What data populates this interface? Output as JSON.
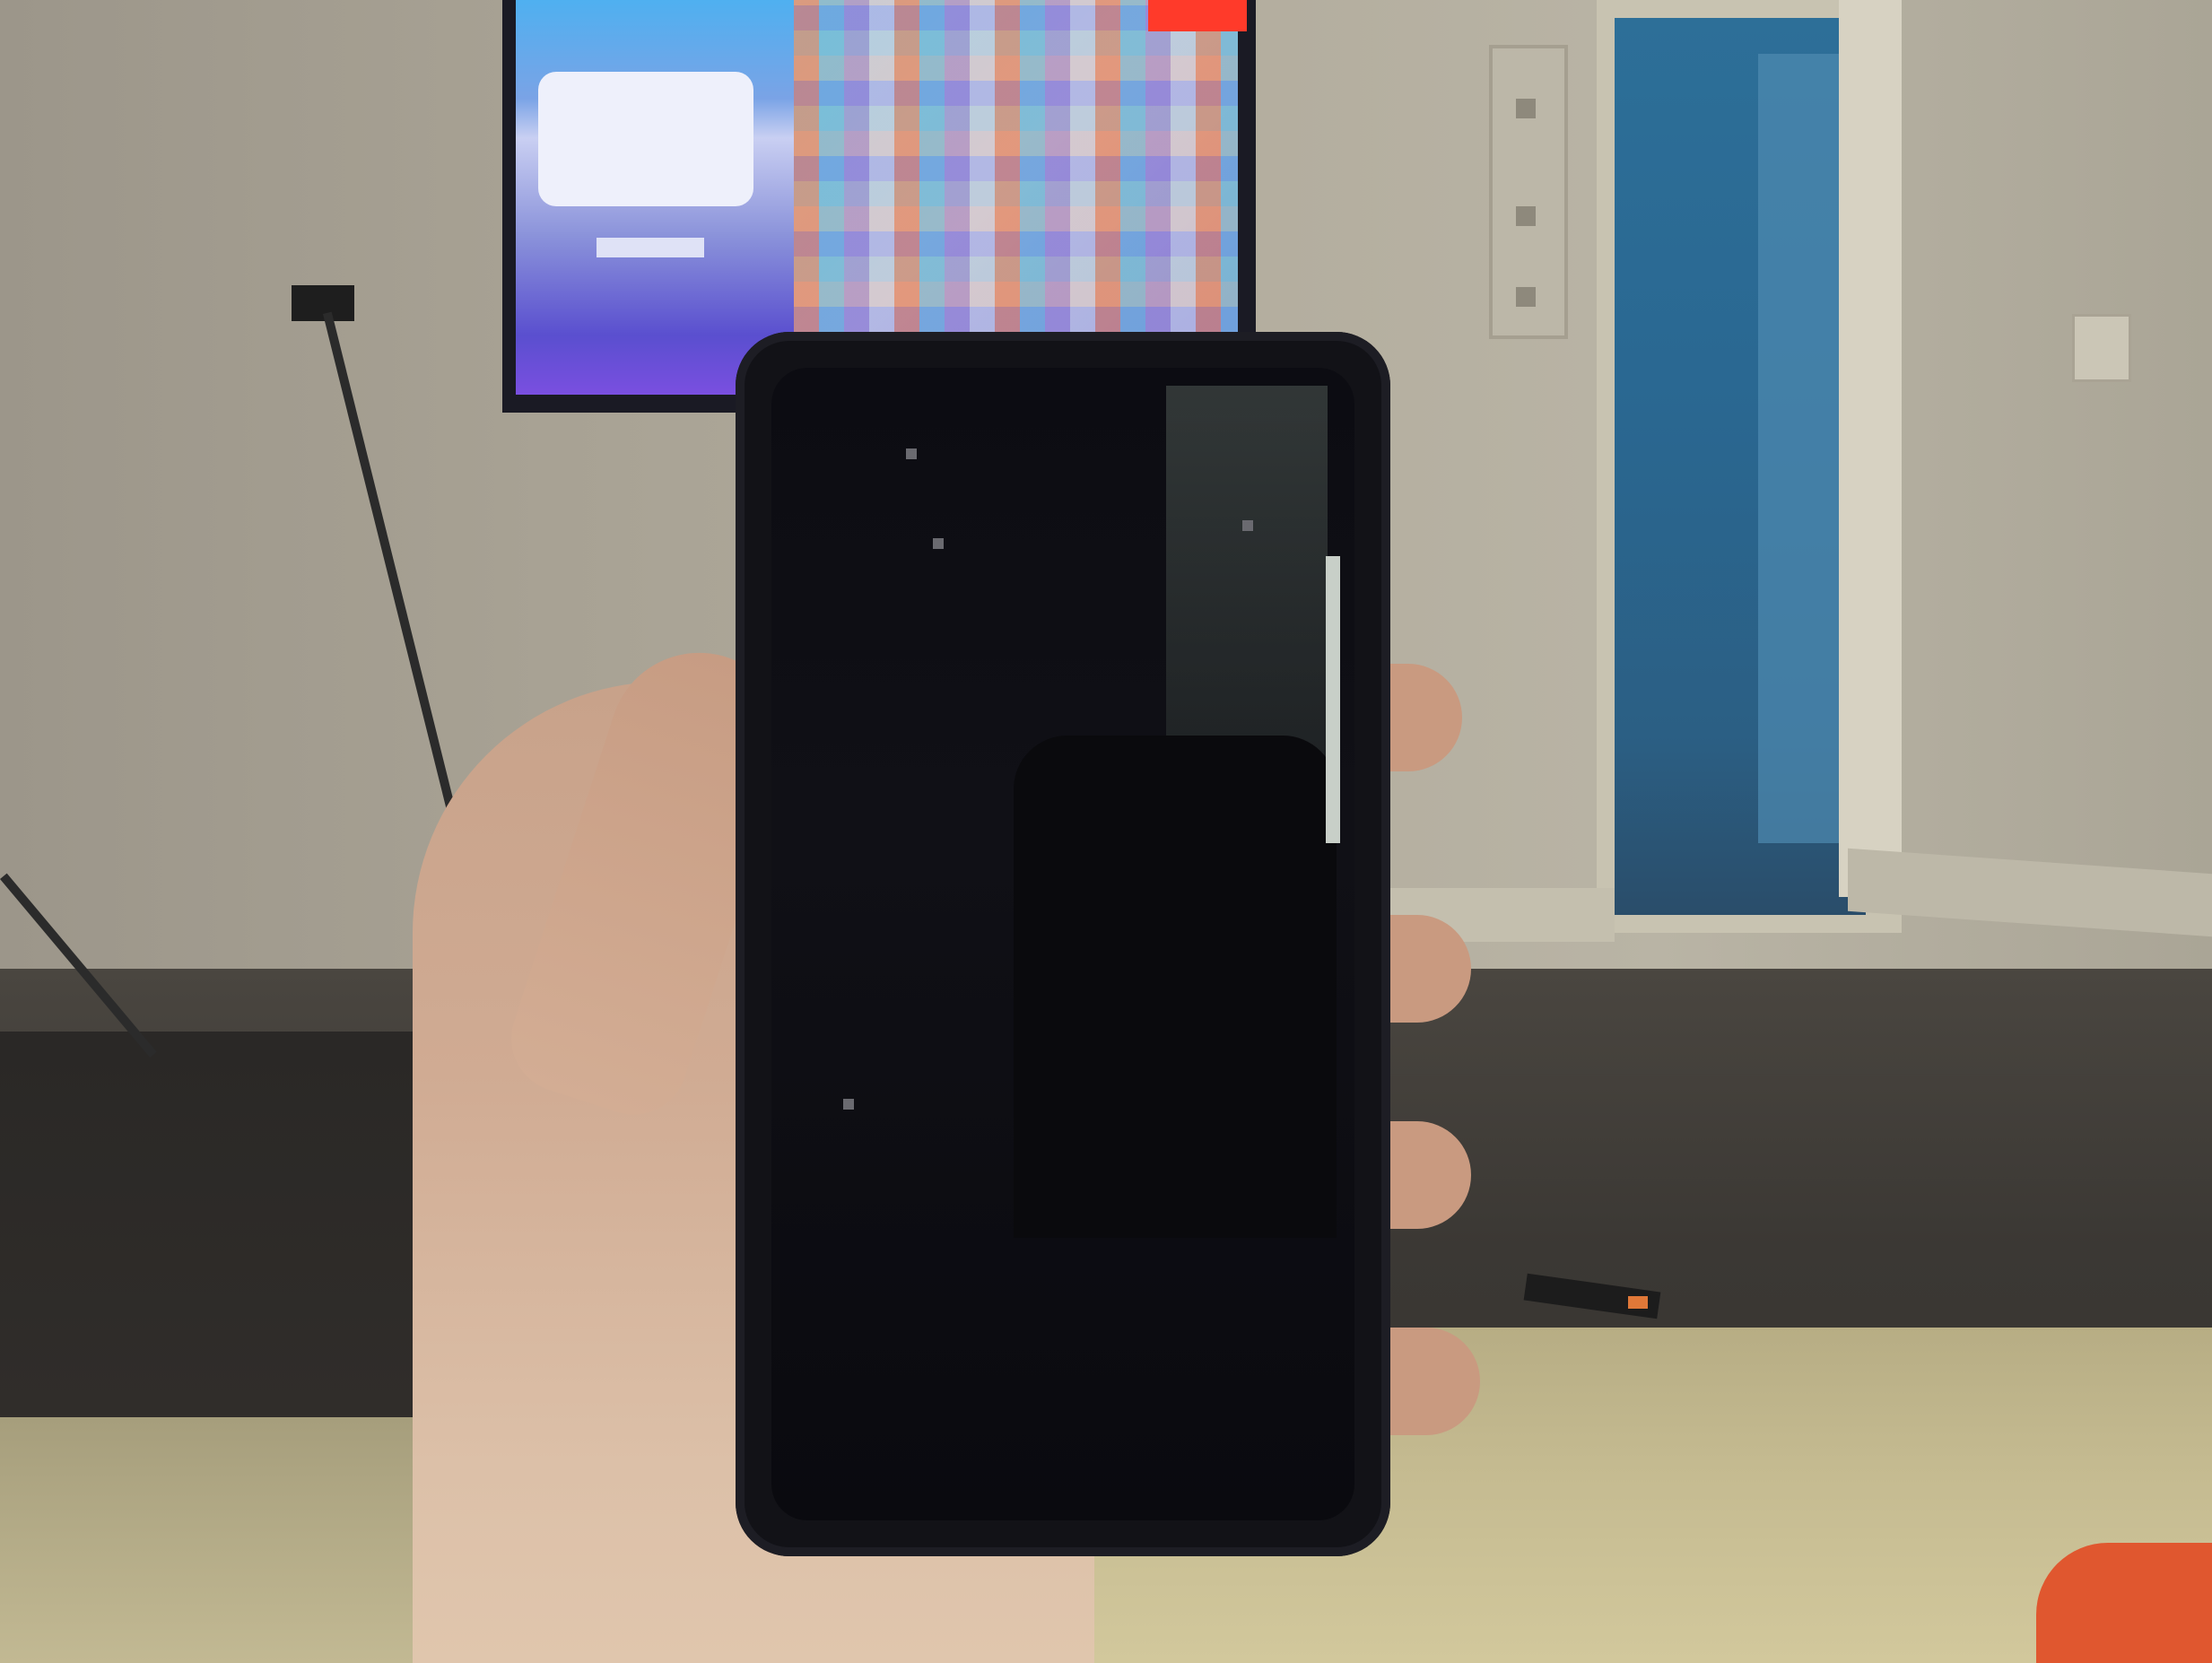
{
  "scene": {
    "description_visible_text": "",
    "colors": {
      "wall": "#b3ad9e",
      "doorway": "#2d6f98",
      "phone_body": "#121217",
      "skin": "#d0ab93",
      "couch": "#c4ba90",
      "floor": "#3b3834"
    },
    "objects": {
      "tv": "tv-icon",
      "phone": "phone-icon",
      "hand": "hand-icon",
      "remote": "remote-icon"
    }
  }
}
